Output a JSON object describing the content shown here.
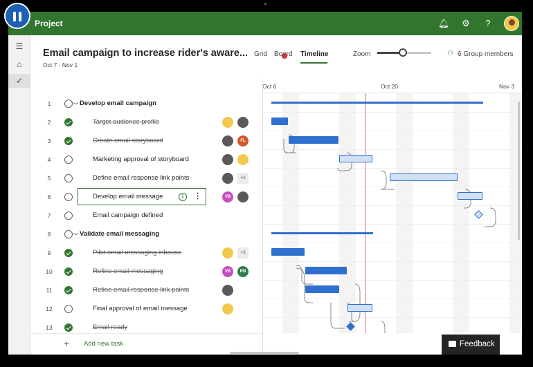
{
  "app": {
    "title": "Project"
  },
  "plan": {
    "title": "Email campaign to increase rider's aware...",
    "dates": "Oct 7 - Nov 1"
  },
  "views": {
    "grid": "Grid",
    "board": "Board",
    "timeline": "Timeline",
    "active": "Timeline"
  },
  "zoom": {
    "label": "Zoom",
    "level": 0.48
  },
  "members": {
    "label": "6 Group members"
  },
  "timeline_dates": [
    "Oct 6",
    "Oct 20",
    "Nov 3"
  ],
  "tasks": [
    {
      "num": "1",
      "name": "Develop email campaign",
      "group": true,
      "done": false
    },
    {
      "num": "2",
      "name": "Target audience profile",
      "done": true,
      "assignees": [
        "photo-yellow",
        "photo-dark"
      ]
    },
    {
      "num": "3",
      "name": "Create email storyboard",
      "done": true,
      "assignees": [
        "photo-dark",
        "FL"
      ]
    },
    {
      "num": "4",
      "name": "Marketing approval of storyboard",
      "done": false,
      "assignees": [
        "photo-dark",
        "photo-yellow"
      ]
    },
    {
      "num": "5",
      "name": "Define email response link points",
      "done": false,
      "assignees": [
        "photo-dark"
      ],
      "more": "+2"
    },
    {
      "num": "6",
      "name": "Develop email message",
      "done": false,
      "selected": true,
      "assignees": [
        "VB",
        "photo-dark"
      ]
    },
    {
      "num": "7",
      "name": "Email campaign defined",
      "done": false
    },
    {
      "num": "8",
      "name": "Validate email messaging",
      "group": true,
      "done": false
    },
    {
      "num": "9",
      "name": "Pilot email messaging inhouse",
      "done": true,
      "assignees": [
        "photo-yellow"
      ],
      "more": "+2"
    },
    {
      "num": "10",
      "name": "Refine email messaging",
      "done": true,
      "assignees": [
        "VB",
        "RB"
      ]
    },
    {
      "num": "11",
      "name": "Refine email response link points",
      "done": true,
      "assignees": [
        "photo-dark"
      ]
    },
    {
      "num": "12",
      "name": "Final approval of email message",
      "done": false,
      "assignees": [
        "photo-yellow"
      ]
    },
    {
      "num": "13",
      "name": "Email ready",
      "done": true
    }
  ],
  "add_task": {
    "label": "Add new task"
  },
  "feedback": {
    "label": "Feedback"
  },
  "colors": {
    "brand": "#31752f",
    "bar": "#2f6fce",
    "today": "#e46a6a"
  },
  "icons": [
    "pause-icon",
    "bell-icon",
    "gear-icon",
    "help-icon",
    "menu-icon",
    "home-icon",
    "check-icon",
    "group-members-icon",
    "info-icon",
    "more-icon",
    "plus-icon",
    "feedback-icon"
  ]
}
